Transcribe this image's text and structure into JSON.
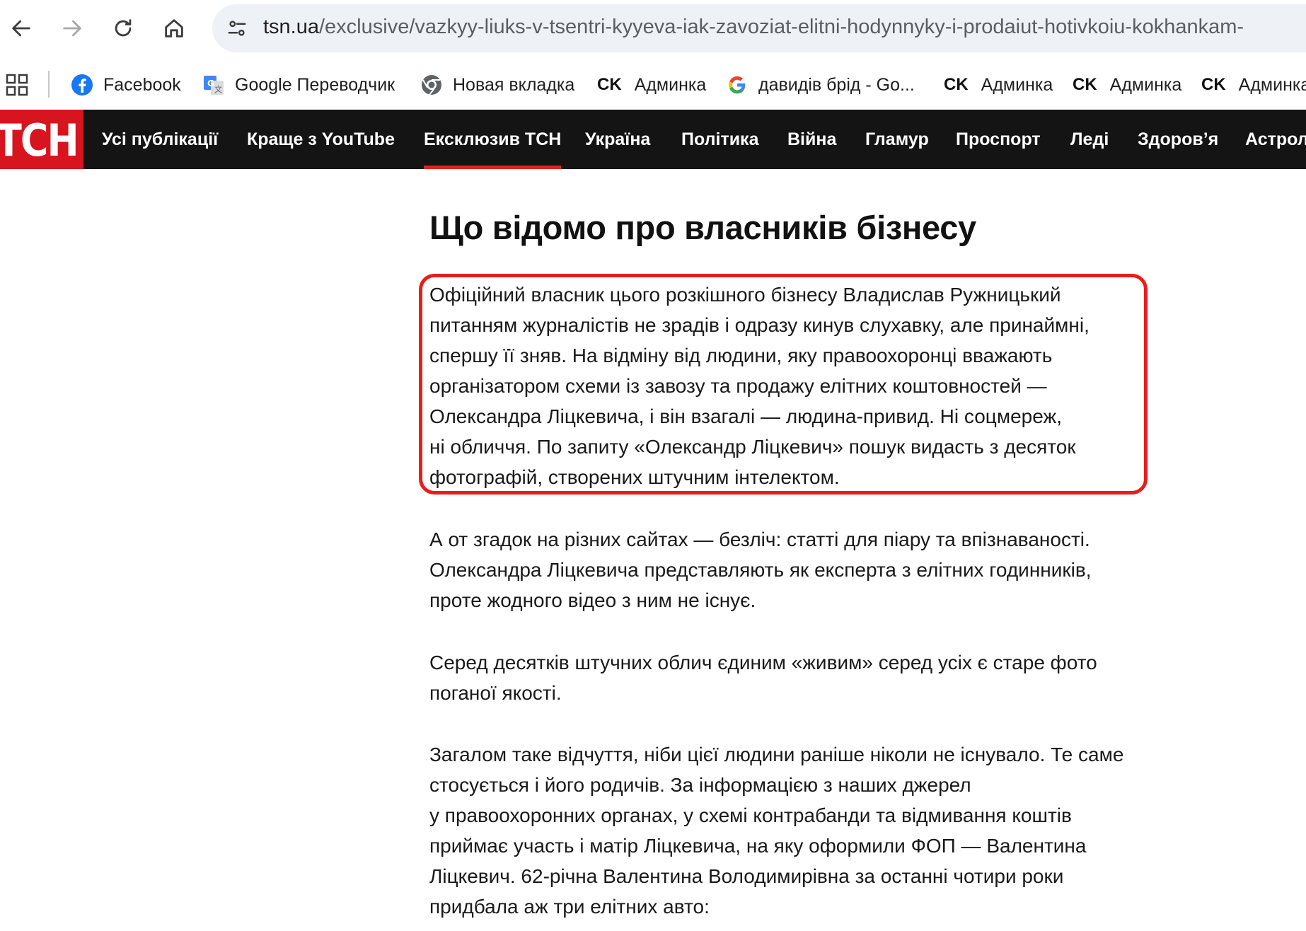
{
  "browser": {
    "url_host": "tsn.ua",
    "url_path": "/exclusive/vazkyy-liuks-v-tsentri-kyyeva-iak-zavoziat-elitni-hodynnyky-i-prodaiut-hotivkoiu-kokhankam-"
  },
  "bookmarks": [
    {
      "label": "Facebook",
      "icon": "facebook-icon"
    },
    {
      "label": "Google Переводчик",
      "icon": "google-translate-icon"
    },
    {
      "label": "Новая вкладка",
      "icon": "chrome-icon"
    },
    {
      "prefix": "CK",
      "label": "Админка"
    },
    {
      "label": "давидів брід - Go...",
      "icon": "google-icon"
    },
    {
      "prefix": "CK",
      "label": "Админка"
    },
    {
      "prefix": "CK",
      "label": "Админка"
    },
    {
      "prefix": "CK",
      "label": "Админка"
    }
  ],
  "site": {
    "logo": "ТСН",
    "nav": [
      "Усі публікації",
      "Краще з YouTube",
      "Ексклюзив ТСН",
      "Україна",
      "Політика",
      "Війна",
      "Гламур",
      "Проспорт",
      "Леді",
      "Здоров’я",
      "Астрол"
    ],
    "active_nav": "Ексклюзив ТСН",
    "accent_color": "#d7151f"
  },
  "article": {
    "heading": "Що відомо про власників бізнесу",
    "paragraphs": [
      [
        "Офіційний власник цього розкішного бізнесу Владислав Ружницький",
        "питанням журналістів не зрадів і одразу кинув слухавку, але принаймні,",
        "спершу її зняв. На відміну від людини, яку правоохоронці вважають",
        "організатором схеми із завозу та продажу елітних коштовностей —",
        "Олександра Ліцкевича, і він взагалі — людина-привид. Ні соцмереж,",
        "ні обличчя. По запиту «Олександр Ліцкевич» пошук видасть з десяток",
        "фотографій, створених штучним інтелектом."
      ],
      [
        "А от згадок на різних сайтах — безліч: статті для піару та впізнаваності.",
        "Олександра Ліцкевича представляють як експерта з елітних годинників,",
        "проте жодного відео з ним не існує."
      ],
      [
        "Серед десятків штучних облич єдиним «живим» серед усіх є старе фото",
        "поганої якості."
      ],
      [
        "Загалом таке відчуття, ніби цієї людини раніше ніколи не існувало. Те саме",
        "стосується і його родичів. За інформацією з наших джерел",
        "у правоохоронних органах, у схемі контрабанди та відмивання коштів",
        "приймає участь і матір Ліцкевича, на яку оформили ФОП — Валентина",
        "Ліцкевич. 62-річна Валентина Володимирівна за останні чотири роки",
        "придбала аж три елітних авто:"
      ]
    ],
    "highlight_color": "#ea1c1c"
  }
}
